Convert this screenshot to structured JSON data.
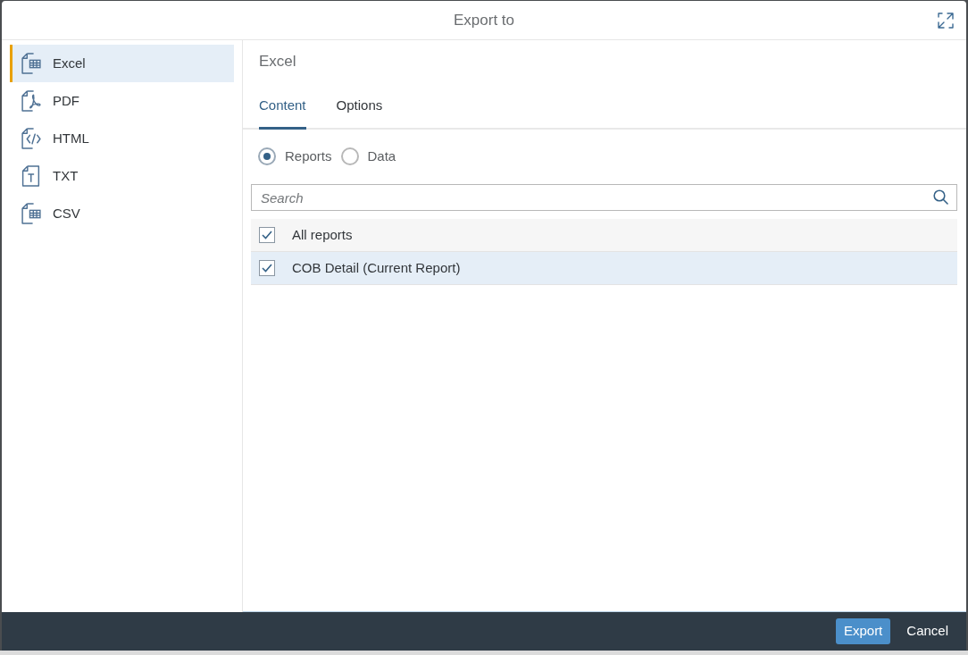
{
  "dialog": {
    "title": "Export to"
  },
  "formats": [
    {
      "label": "Excel",
      "kind": "grid",
      "selected": true
    },
    {
      "label": "PDF",
      "kind": "pdf",
      "selected": false
    },
    {
      "label": "HTML",
      "kind": "code",
      "selected": false
    },
    {
      "label": "TXT",
      "kind": "text",
      "selected": false
    },
    {
      "label": "CSV",
      "kind": "grid",
      "selected": false
    }
  ],
  "panel": {
    "title": "Excel",
    "tabs": [
      {
        "label": "Content",
        "selected": true
      },
      {
        "label": "Options",
        "selected": false
      }
    ],
    "scope_options": [
      {
        "label": "Reports",
        "selected": true
      },
      {
        "label": "Data",
        "selected": false
      }
    ],
    "search": {
      "placeholder": "Search"
    },
    "reports": [
      {
        "label": "All reports",
        "checked": true,
        "selected": false
      },
      {
        "label": "COB Detail (Current Report)",
        "checked": true,
        "selected": true
      }
    ]
  },
  "footer": {
    "buttons": [
      {
        "label": "Export",
        "kind": "primary"
      },
      {
        "label": "Cancel",
        "kind": "secondary"
      }
    ]
  }
}
